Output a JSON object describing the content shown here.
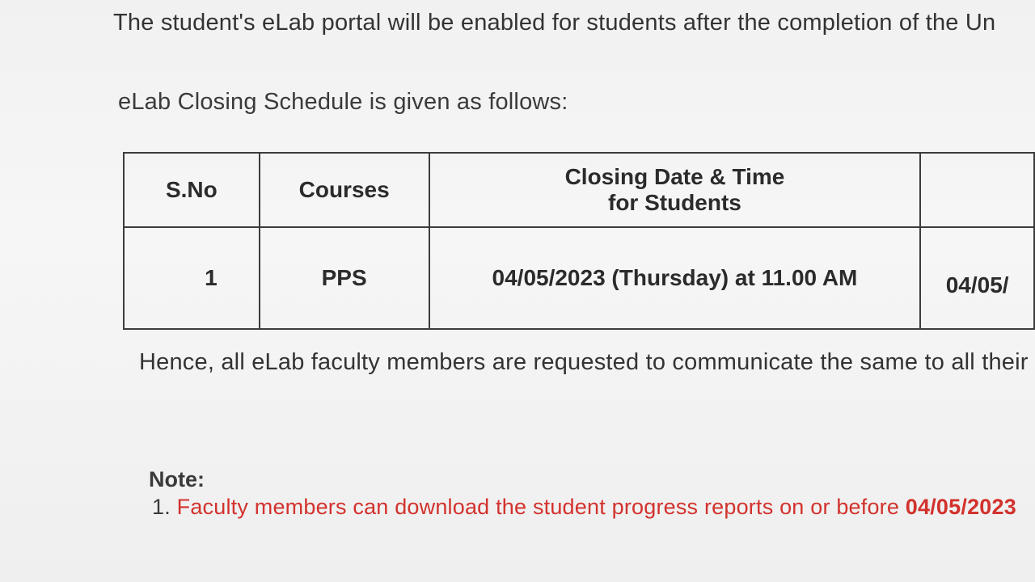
{
  "intro_text": "The student's eLab portal will be enabled for students after the completion of the Un",
  "schedule_heading": "eLab Closing Schedule is given as follows:",
  "table": {
    "headers": {
      "sno": "S.No",
      "courses": "Courses",
      "closing_line1": "Closing Date & Time",
      "closing_line2": "for Students",
      "extra": ""
    },
    "row1": {
      "sno": "1",
      "course": "PPS",
      "closing": "04/05/2023 (Thursday) at 11.00 AM",
      "extra": "04/05/"
    }
  },
  "communication_text": "Hence, all eLab faculty members are requested to communicate the same to all their r",
  "note": {
    "label": "Note:",
    "item1_number": "1.",
    "item1_text": "Faculty members can download the student progress reports on or before",
    "item1_date": "04/05/2023"
  },
  "colors": {
    "background": "#f3f3f3",
    "text": "#2a2a2a",
    "note_red": "#d2322d"
  }
}
